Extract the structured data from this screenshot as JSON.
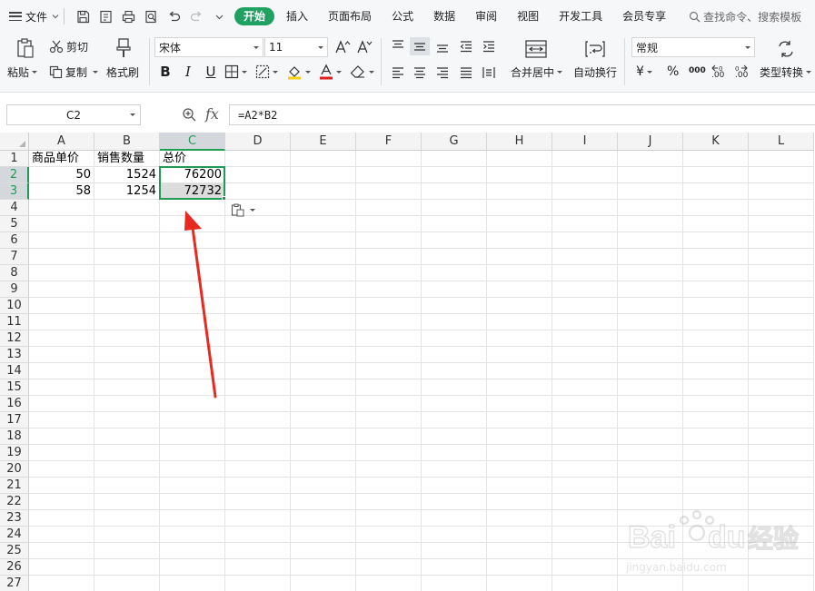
{
  "menubar": {
    "file_label": "文件",
    "tabs": [
      "开始",
      "插入",
      "页面布局",
      "公式",
      "数据",
      "审阅",
      "视图",
      "开发工具",
      "会员专享"
    ],
    "active_tab": "开始",
    "search_label": "查找命令、搜索模板"
  },
  "ribbon": {
    "paste": "粘贴",
    "cut": "剪切",
    "copy": "复制",
    "format_painter": "格式刷",
    "font_name": "宋体",
    "font_size": "11",
    "merge_center": "合并居中",
    "wrap_text": "自动换行",
    "number_format": "常规",
    "type_convert": "类型转换",
    "currency_symbol": "¥",
    "percent_symbol": "%",
    "thousands_symbol": "000",
    "inc_decimal": ".00",
    "dec_decimal": ".00"
  },
  "formula_bar": {
    "name_box": "C2",
    "fx": "fx",
    "formula": "=A2*B2"
  },
  "sheet": {
    "columns": [
      "A",
      "B",
      "C",
      "D",
      "E",
      "F",
      "G",
      "H",
      "I",
      "J",
      "K",
      "L"
    ],
    "rows": [
      "1",
      "2",
      "3",
      "4",
      "5",
      "6",
      "7",
      "8",
      "9",
      "10",
      "11",
      "12",
      "13",
      "14",
      "15",
      "16",
      "17",
      "18",
      "19",
      "20",
      "21",
      "22",
      "23",
      "24",
      "25",
      "26",
      "27"
    ],
    "selected_column": "C",
    "selected_rows": [
      "2",
      "3"
    ],
    "cells": {
      "A1": "商品单价",
      "B1": "销售数量",
      "C1": "总价",
      "A2": "50",
      "B2": "1524",
      "C2": "76200",
      "A3": "58",
      "B3": "1254",
      "C3": "72732"
    }
  },
  "colors": {
    "accent": "#1f9d55",
    "active_tab_bg": "#20a162",
    "annotation_arrow": "#e8291f"
  },
  "watermark": {
    "brand": "Baidu经验",
    "url": "jingyan.baidu.com"
  }
}
